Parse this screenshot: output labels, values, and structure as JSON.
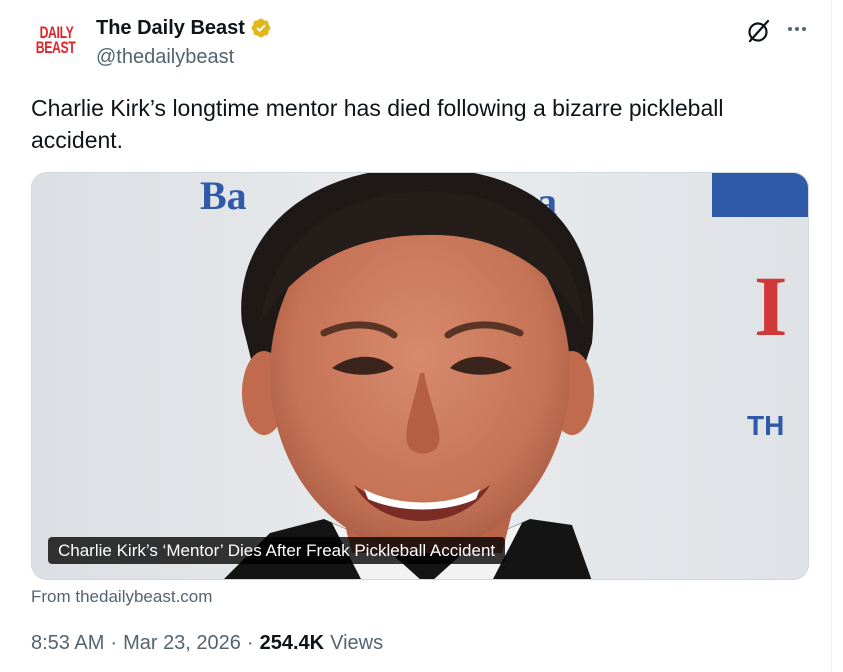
{
  "author": {
    "display_name": "The Daily Beast",
    "handle": "@thedailybeast",
    "avatar_logo_lines": [
      "DAILY",
      "BEAST"
    ],
    "verified_badge_color": "#e2b719"
  },
  "tweet": {
    "text": "Charlie Kirk’s longtime mentor has died following a bizarre pickleball accident."
  },
  "card": {
    "caption": "Charlie Kirk’s ‘Mentor’ Dies After Freak Pickleball Accident",
    "source": "From thedailybeast.com"
  },
  "meta": {
    "time": "8:53 AM",
    "separator": "·",
    "date": "Mar 23, 2026",
    "views_count": "254.4K",
    "views_label": "Views"
  },
  "icons": {
    "verified": "verified-badge-icon",
    "grok": "grok-icon",
    "more": "more-options-icon"
  }
}
